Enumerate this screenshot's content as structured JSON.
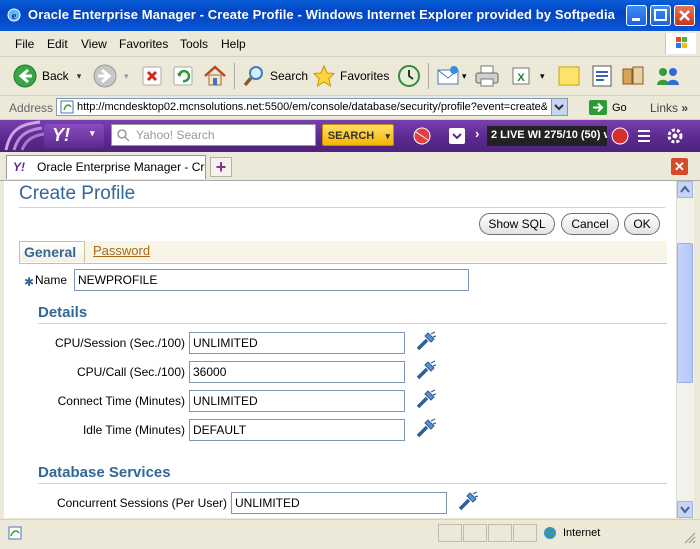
{
  "window": {
    "title": "Oracle Enterprise Manager - Create Profile - Windows Internet Explorer provided by Softpedia"
  },
  "menu": [
    "File",
    "Edit",
    "View",
    "Favorites",
    "Tools",
    "Help"
  ],
  "toolbar": {
    "back": "Back",
    "search": "Search",
    "favorites": "Favorites"
  },
  "address": {
    "label": "Address",
    "url": "http://mcndesktop02.mcnsolutions.net:5500/em/console/database/security/profile?event=create&cancel",
    "go": "Go",
    "links": "Links"
  },
  "yahoo": {
    "search_placeholder": "Yahoo! Search",
    "search_button": "SEARCH",
    "score": "2 LIVE  WI 275/10 (50) v"
  },
  "tab": {
    "label": "Oracle Enterprise Manager - Cre..."
  },
  "page": {
    "title": "Create Profile",
    "show_sql": "Show SQL",
    "cancel": "Cancel",
    "ok": "OK",
    "tabs": [
      "General",
      "Password"
    ],
    "name_label": "Name",
    "name_value": "NEWPROFILE",
    "details": {
      "heading": "Details",
      "fields": [
        {
          "label": "CPU/Session (Sec./100)",
          "value": "UNLIMITED"
        },
        {
          "label": "CPU/Call (Sec./100)",
          "value": "36000"
        },
        {
          "label": "Connect Time (Minutes)",
          "value": "UNLIMITED"
        },
        {
          "label": "Idle Time (Minutes)",
          "value": "DEFAULT"
        }
      ]
    },
    "db_services": {
      "heading": "Database Services",
      "fields": [
        {
          "label": "Concurrent Sessions (Per User)",
          "value": "UNLIMITED"
        }
      ]
    }
  },
  "status": {
    "zone": "Internet"
  },
  "colors": {
    "accent": "#336699",
    "titlebar": "#0a5fd8"
  }
}
